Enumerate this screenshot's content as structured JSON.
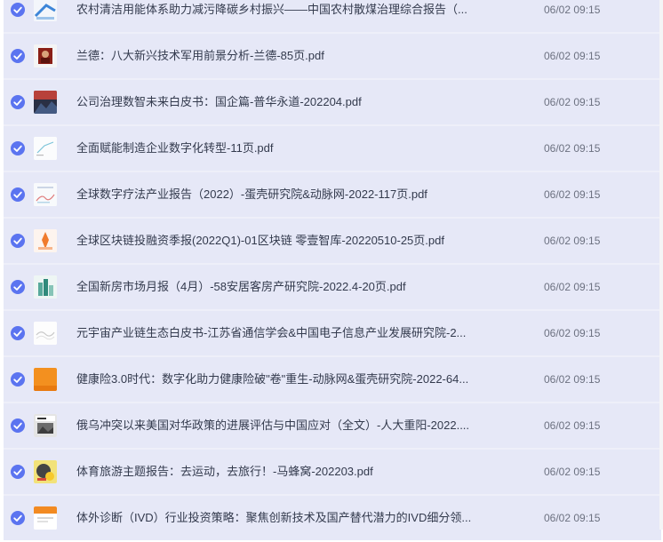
{
  "files": [
    {
      "name": "农村清洁用能体系助力减污降碳乡村振兴——中国农村散煤治理综合报告（...",
      "time": "06/02 09:15",
      "thumb": "blue-arrow-cover"
    },
    {
      "name": "兰德：八大新兴技术军用前景分析-兰德-85页.pdf",
      "time": "06/02 09:15",
      "thumb": "red-portrait-cover"
    },
    {
      "name": "公司治理数智未来白皮书：国企篇-普华永道-202204.pdf",
      "time": "06/02 09:15",
      "thumb": "dark-red-cover"
    },
    {
      "name": "全面赋能制造企业数字化转型-11页.pdf",
      "time": "06/02 09:15",
      "thumb": "white-line-cover"
    },
    {
      "name": "全球数字疗法产业报告（2022）-蛋壳研究院&动脉网-2022-117页.pdf",
      "time": "06/02 09:15",
      "thumb": "light-chart-cover"
    },
    {
      "name": "全球区块链投融资季报(2022Q1)-01区块链 零壹智库-20220510-25页.pdf",
      "time": "06/02 09:15",
      "thumb": "orange-hand-cover"
    },
    {
      "name": "全国新房市场月报（4月）-58安居客房产研究院-2022.4-20页.pdf",
      "time": "06/02 09:15",
      "thumb": "teal-building-cover"
    },
    {
      "name": "元宇宙产业链生态白皮书-江苏省通信学会&中国电子信息产业发展研究院-2...",
      "time": "06/02 09:15",
      "thumb": "white-wave-cover"
    },
    {
      "name": "健康险3.0时代：数字化助力健康险破\"卷\"重生-动脉网&蛋壳研究院-2022-64...",
      "time": "06/02 09:15",
      "thumb": "orange-block-cover"
    },
    {
      "name": "俄乌冲突以来美国对华政策的进展评估与中国应对（全文）-人大重阳-2022....",
      "time": "06/02 09:15",
      "thumb": "gray-photo-cover"
    },
    {
      "name": "体育旅游主题报告：去运动，去旅行！-马蜂窝-202203.pdf",
      "time": "06/02 09:15",
      "thumb": "sport-badge-cover"
    },
    {
      "name": "体外诊断（IVD）行业投资策略：聚焦创新技术及国产替代潜力的IVD细分领...",
      "time": "06/02 09:15",
      "thumb": "orange-band-cover"
    }
  ]
}
